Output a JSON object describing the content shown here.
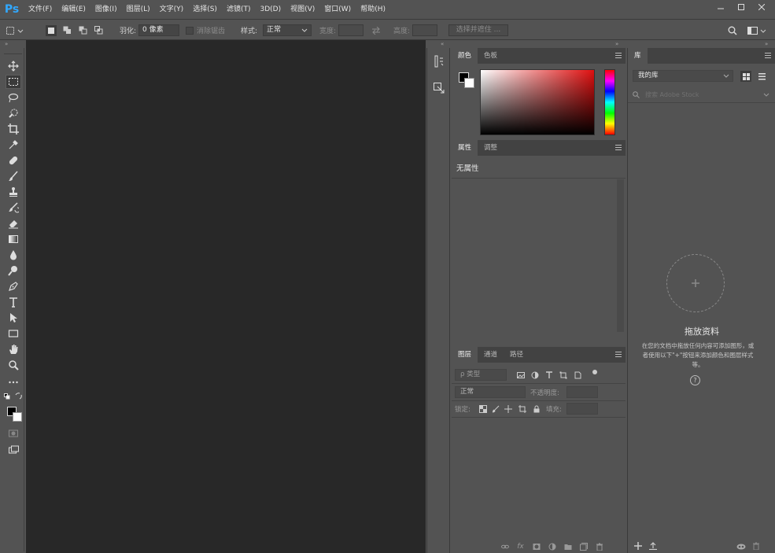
{
  "app": {
    "logo": "Ps"
  },
  "menu": [
    "文件(F)",
    "编辑(E)",
    "图像(I)",
    "图层(L)",
    "文字(Y)",
    "选择(S)",
    "滤镜(T)",
    "3D(D)",
    "视图(V)",
    "窗口(W)",
    "帮助(H)"
  ],
  "options": {
    "feather_label": "羽化:",
    "feather_value": "0 像素",
    "antialias_label": "消除锯齿",
    "style_label": "样式:",
    "style_value": "正常",
    "width_label": "宽度:",
    "height_label": "高度:",
    "select_mask_button": "选择并遮住 ..."
  },
  "color_panel": {
    "tabs": [
      "颜色",
      "色板"
    ],
    "accent": "#e01010"
  },
  "props_panel": {
    "tabs": [
      "属性",
      "调整"
    ],
    "no_props": "无属性"
  },
  "layers_panel": {
    "tabs": [
      "图层",
      "通道",
      "路径"
    ],
    "filter_label": "ρ 类型",
    "blend_value": "正常",
    "opacity_label": "不透明度:",
    "lock_label": "锁定:",
    "fill_label": "填充:"
  },
  "library_panel": {
    "tab": "库",
    "library_select": "我的库",
    "search_placeholder": "搜索 Adobe Stock",
    "drop_title": "拖放资料",
    "drop_desc": "在您的文档中拖放任何内容可添加图形，或者使用以下\"+\"按钮来添加颜色和图层样式等。"
  }
}
